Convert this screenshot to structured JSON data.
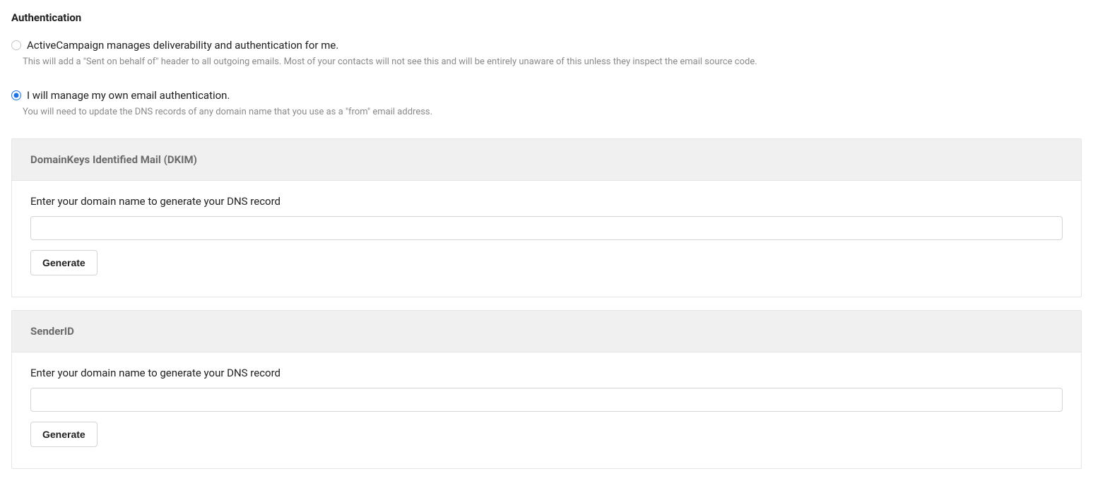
{
  "section": {
    "title": "Authentication"
  },
  "options": {
    "managed": {
      "label": "ActiveCampaign manages deliverability and authentication for me.",
      "description": "This will add a \"Sent on behalf of\" header to all outgoing emails. Most of your contacts will not see this and will be entirely unaware of this unless they inspect the email source code.",
      "checked": false
    },
    "self": {
      "label": "I will manage my own email authentication.",
      "description": "You will need to update the DNS records of any domain name that you use as a \"from\" email address.",
      "checked": true
    }
  },
  "dkim": {
    "header": "DomainKeys Identified Mail (DKIM)",
    "prompt": "Enter your domain name to generate your DNS record",
    "input_value": "",
    "button_label": "Generate"
  },
  "senderid": {
    "header": "SenderID",
    "prompt": "Enter your domain name to generate your DNS record",
    "input_value": "",
    "button_label": "Generate"
  }
}
